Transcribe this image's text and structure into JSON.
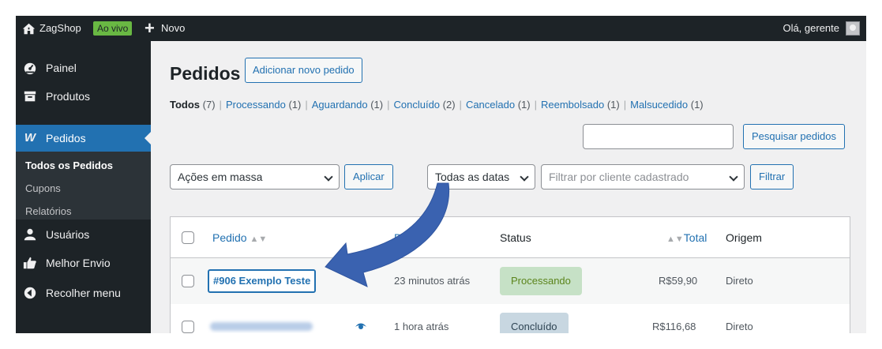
{
  "admin_bar": {
    "site_name": "ZagShop",
    "live_badge": "Ao vivo",
    "new_label": "Novo",
    "greeting": "Olá, gerente"
  },
  "sidebar": {
    "items": [
      {
        "label": "Painel",
        "icon": "dashboard-icon"
      },
      {
        "label": "Produtos",
        "icon": "archive-icon"
      },
      {
        "label": "Pedidos",
        "icon": "woocommerce-icon"
      },
      {
        "label": "Usuários",
        "icon": "user-icon"
      },
      {
        "label": "Melhor Envio",
        "icon": "thumbs-up-icon"
      },
      {
        "label": "Recolher menu",
        "icon": "collapse-icon"
      }
    ],
    "submenu": [
      {
        "label": "Todos os Pedidos"
      },
      {
        "label": "Cupons"
      },
      {
        "label": "Relatórios"
      }
    ]
  },
  "page": {
    "title": "Pedidos",
    "add_button": "Adicionar novo pedido"
  },
  "filters_status": [
    {
      "label": "Todos",
      "count": "(7)"
    },
    {
      "label": "Processando",
      "count": "(1)"
    },
    {
      "label": "Aguardando",
      "count": "(1)"
    },
    {
      "label": "Concluído",
      "count": "(2)"
    },
    {
      "label": "Cancelado",
      "count": "(1)"
    },
    {
      "label": "Reembolsado",
      "count": "(1)"
    },
    {
      "label": "Malsucedido",
      "count": "(1)"
    }
  ],
  "search": {
    "value": "",
    "button": "Pesquisar pedidos"
  },
  "toolbar": {
    "bulk_actions": "Ações em massa",
    "apply": "Aplicar",
    "dates": "Todas as datas",
    "customer_placeholder": "Filtrar por cliente cadastrado",
    "filter": "Filtrar"
  },
  "table": {
    "columns": {
      "order": "Pedido",
      "date": "Data",
      "status": "Status",
      "total": "Total",
      "origin": "Origem"
    },
    "rows": [
      {
        "order": "#906 Exemplo Teste",
        "date": "23 minutos atrás",
        "status": "Processando",
        "total": "R$59,90",
        "origin": "Direto"
      },
      {
        "order": "",
        "date": "1 hora atrás",
        "status": "Concluído",
        "total": "R$116,68",
        "origin": "Direto"
      }
    ]
  },
  "colors": {
    "accent": "#2271b1",
    "admin_dark": "#1d2327",
    "live_green": "#69b843",
    "processing_bg": "#c6e1c6",
    "completed_bg": "#c8d7e1",
    "arrow": "#3a62b0"
  }
}
